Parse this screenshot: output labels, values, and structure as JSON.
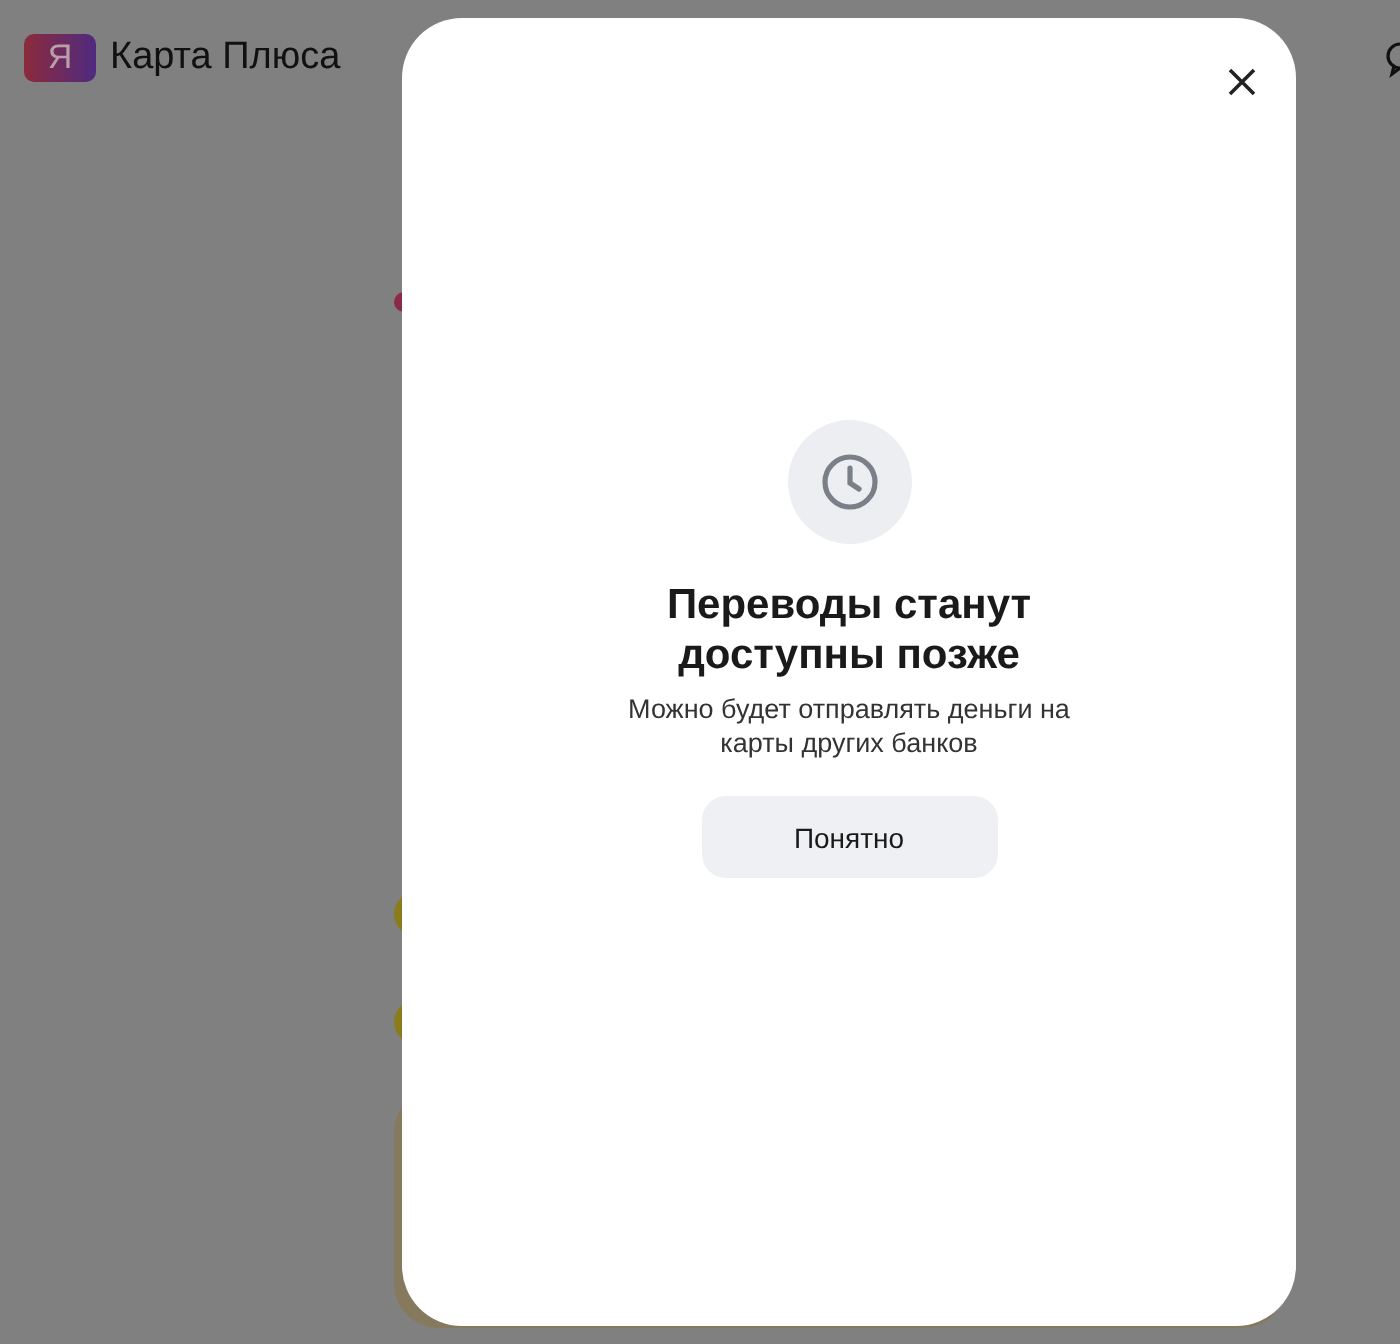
{
  "header": {
    "logo_letter": "Я",
    "title": "Карта Плюса"
  },
  "modal": {
    "title": "Переводы станут доступны позже",
    "message": "Можно будет отправлять деньги на карты других банков",
    "button": "Понятно"
  }
}
